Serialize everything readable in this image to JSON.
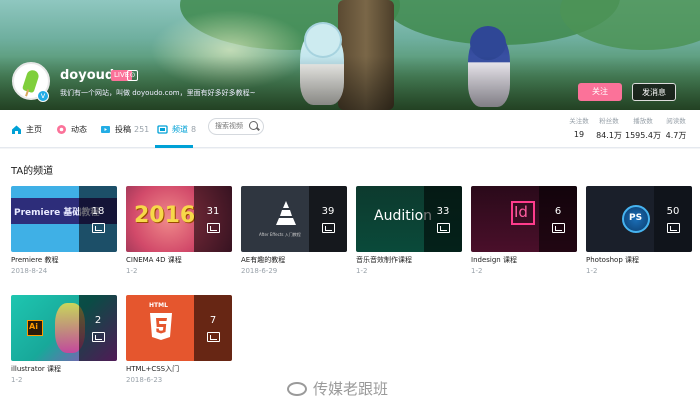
{
  "profile": {
    "username": "doyoudo",
    "live_badge": "LIVE",
    "level_badge": "⊙",
    "verified_badge": "v",
    "signature": "我们有一个网站，叫做 doyoudo.com，里面有好多好多教程~"
  },
  "actions": {
    "follow": "关注",
    "message": "发消息"
  },
  "nav": {
    "items": [
      {
        "label": "主页",
        "count": ""
      },
      {
        "label": "动态",
        "count": ""
      },
      {
        "label": "投稿",
        "count": "251"
      },
      {
        "label": "频道",
        "count": "8"
      }
    ],
    "search_placeholder": "搜索视频"
  },
  "stats": [
    {
      "label": "关注数",
      "value": "19"
    },
    {
      "label": "粉丝数",
      "value": "84.1万"
    },
    {
      "label": "播放数",
      "value": "1595.4万"
    },
    {
      "label": "阅读数",
      "value": "4.7万"
    }
  ],
  "section_title": "TA的频道",
  "channels": [
    {
      "title": "Premiere 教程",
      "date": "2018-8-24",
      "count": "18",
      "thumb_text": "Premiere 基础教程"
    },
    {
      "title": "CINEMA 4D 课程",
      "date": "1-2",
      "count": "31",
      "thumb_text": "2016"
    },
    {
      "title": "AE有趣的教程",
      "date": "2018-6-29",
      "count": "39",
      "thumb_text": "After Effects 入门教程"
    },
    {
      "title": "音乐音效制作课程",
      "date": "1-2",
      "count": "33",
      "thumb_text": "Audition"
    },
    {
      "title": "Indesign 课程",
      "date": "1-2",
      "count": "6",
      "thumb_text": "Id"
    },
    {
      "title": "Photoshop 课程",
      "date": "1-2",
      "count": "50",
      "thumb_text": "PS"
    },
    {
      "title": "illustrator 课程",
      "date": "1-2",
      "count": "2",
      "thumb_text": "Ai"
    },
    {
      "title": "HTML+CSS入门",
      "date": "2018-6-23",
      "count": "7",
      "thumb_text": "HTML"
    }
  ],
  "watermark": "传媒老跟班",
  "colors": {
    "accent_blue": "#00a1d6",
    "follow_pink": "#fb7299"
  }
}
